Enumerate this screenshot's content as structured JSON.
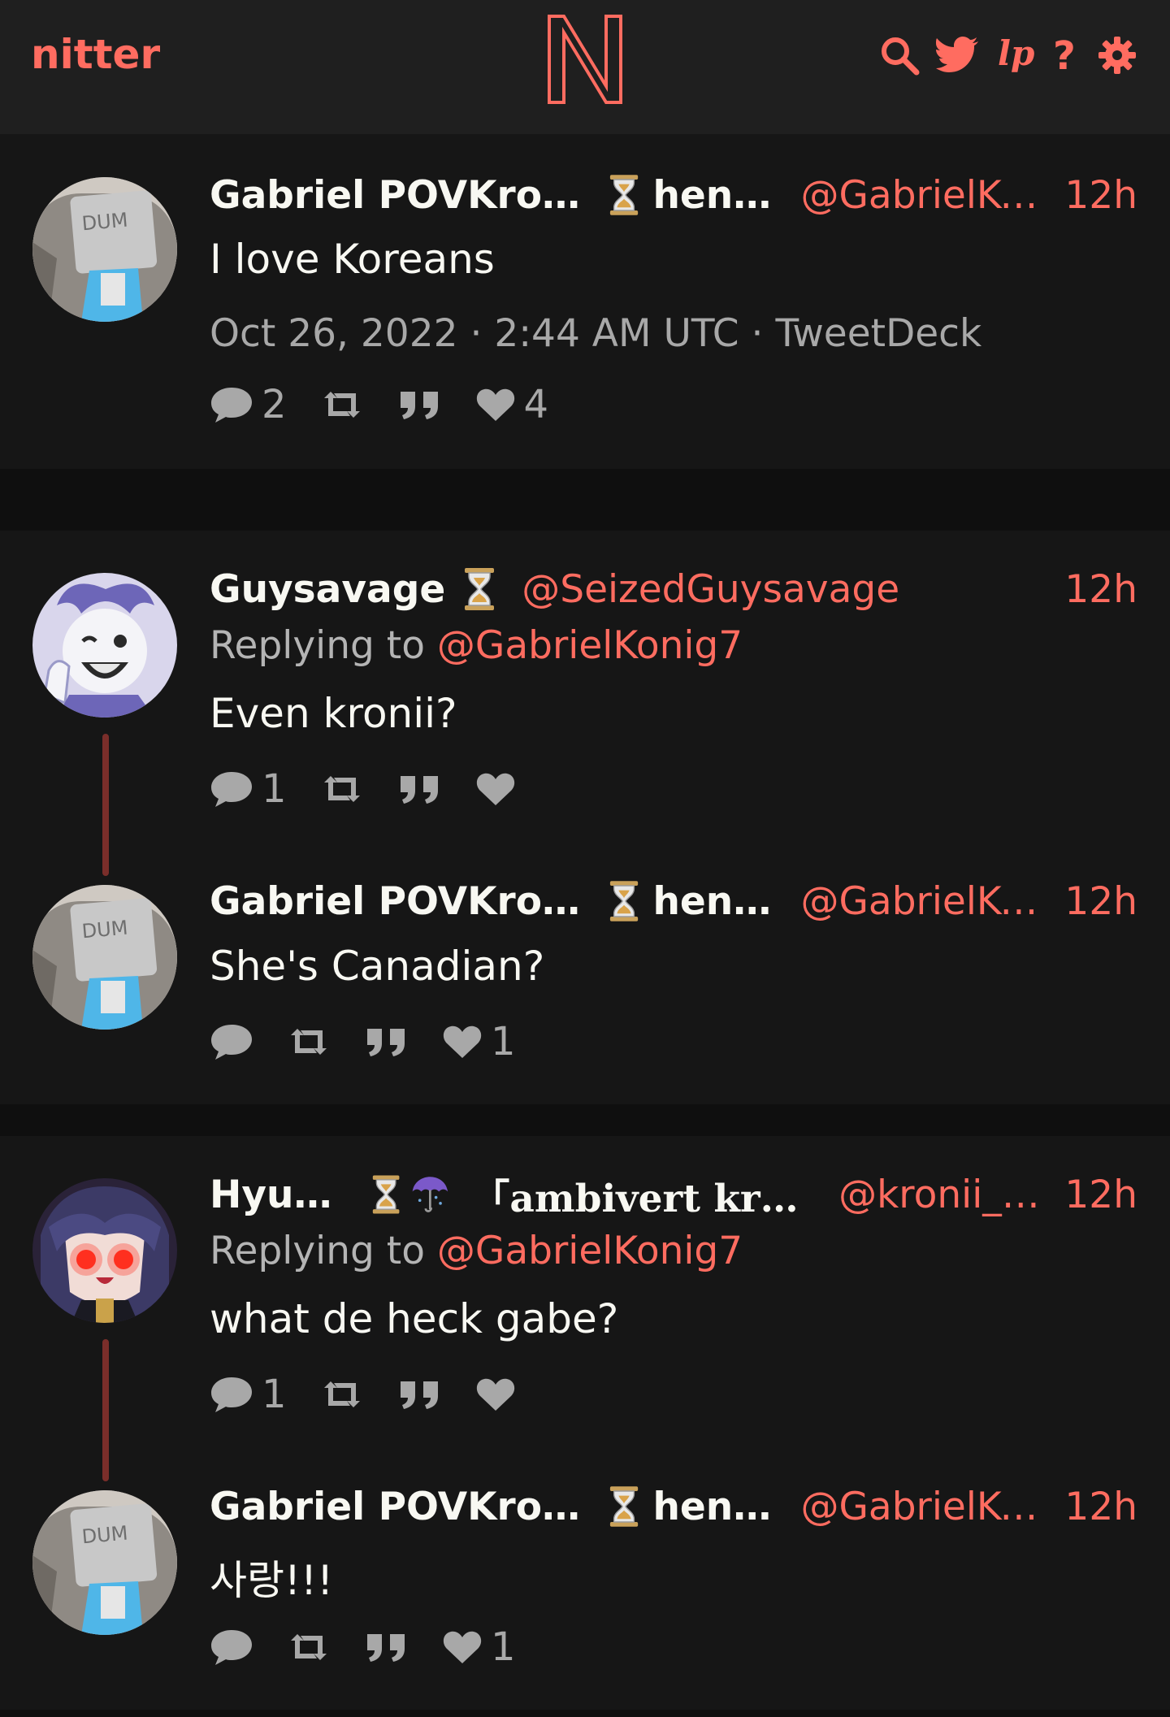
{
  "navbar": {
    "brand": "nitter",
    "icons": [
      "search-icon",
      "twitter-bird-icon",
      "lp-icon",
      "help-icon",
      "gear-icon"
    ],
    "accent": "#ff6c60"
  },
  "main_tweet": {
    "fullname": "Gabriel POVKroniig",
    "name_suffix": "henl…",
    "handle": "@GabrielKo…",
    "time": "12h",
    "text": "I love Koreans",
    "date_line": "Oct 26, 2022 · 2:44 AM UTC · TweetDeck",
    "stats": {
      "replies": "2",
      "retweets": "",
      "quotes": "",
      "likes": "4"
    }
  },
  "thread1": [
    {
      "fullname": "Guysavage",
      "handle": "@SeizedGuysavage",
      "time": "12h",
      "replying_label": "Replying to ",
      "replying_to": "@GabrielKonig7",
      "text": "Even kronii?",
      "stats": {
        "replies": "1",
        "retweets": "",
        "quotes": "",
        "likes": ""
      }
    },
    {
      "fullname": "Gabriel POVKroniig",
      "name_suffix": "henl…",
      "handle": "@GabrielKo…",
      "time": "12h",
      "text": "She's Canadian?",
      "stats": {
        "replies": "",
        "retweets": "",
        "quotes": "",
        "likes": "1"
      }
    }
  ],
  "thread2": [
    {
      "fullname": "Hyukaa",
      "name_suffix": "「ambivert kron…",
      "handle": "@kronii_si…",
      "time": "12h",
      "replying_label": "Replying to ",
      "replying_to": "@GabrielKonig7",
      "text": "what de heck gabe?",
      "stats": {
        "replies": "1",
        "retweets": "",
        "quotes": "",
        "likes": ""
      }
    },
    {
      "fullname": "Gabriel POVKroniig",
      "name_suffix": "henl…",
      "handle": "@GabrielKo…",
      "time": "12h",
      "text": "사랑!!!",
      "stats": {
        "replies": "",
        "retweets": "",
        "quotes": "",
        "likes": "1"
      }
    }
  ]
}
